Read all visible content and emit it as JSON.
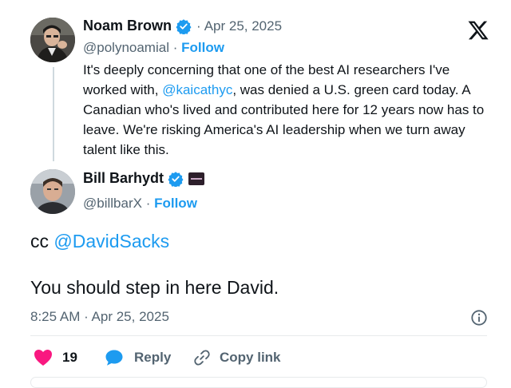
{
  "quoted_tweet": {
    "author_name": "Noam Brown",
    "separator": "·",
    "date": "Apr 25, 2025",
    "handle": "@polynoamial",
    "follow_label": "Follow",
    "text_before": "It's deeply concerning that one of the best AI researchers I've worked with, ",
    "mention": "@kaicathyc",
    "text_after": ", was denied a U.S. green card today. A Canadian who's lived and contributed here for 12 years now has to leave. We're risking America's AI leadership when we turn away talent like this."
  },
  "reply_tweet": {
    "author_name": "Bill Barhydt",
    "handle": "@billbarX",
    "separator": "·",
    "follow_label": "Follow",
    "line1_prefix": "cc ",
    "line1_mention": "@DavidSacks",
    "line2": "You should step in here David.",
    "timestamp": "8:25 AM · Apr 25, 2025"
  },
  "actions": {
    "like_count": "19",
    "reply_label": "Reply",
    "copy_link_label": "Copy link"
  },
  "colors": {
    "accent_blue": "#1d9bf0",
    "like_red": "#f91880",
    "text_grey": "#536471"
  },
  "icons": {
    "platform_logo": "x-logo-icon",
    "verified": "verified-badge-icon",
    "affiliate": "affiliate-badge-icon",
    "info": "info-icon",
    "like": "heart-icon",
    "reply": "reply-bubble-icon",
    "copy_link": "link-icon"
  }
}
